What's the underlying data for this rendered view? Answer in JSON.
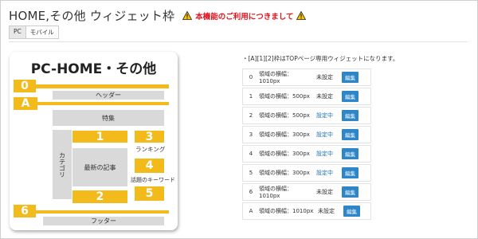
{
  "header": {
    "title": "HOME,その他 ウィジェット枠",
    "notice": "本機能のご利用につきまして"
  },
  "tabs": [
    {
      "label": "PC",
      "active": true
    },
    {
      "label": "モバイル",
      "active": false
    }
  ],
  "diagram": {
    "title": "PC-HOME・その他",
    "tags": [
      "0",
      "A",
      "6"
    ],
    "header_label": "ヘッダー",
    "special_label": "特集",
    "category_label": "カテゴリ",
    "latest_label": "最新の記事",
    "ranking_label": "ランキング",
    "keyword_label": "話題のキーワード",
    "footer_label": "フッター",
    "slots": [
      "1",
      "2",
      "3",
      "4",
      "5"
    ]
  },
  "widgets": {
    "note": "・[A][1][2]枠はTOPページ専用ウィジェットになります。",
    "edit_label": "編集",
    "rows": [
      {
        "id": "0",
        "desc": "領域の横幅：1010px",
        "status": "未設定",
        "set": false
      },
      {
        "id": "1",
        "desc": "領域の横幅：500px",
        "status": "未設定",
        "set": false
      },
      {
        "id": "2",
        "desc": "領域の横幅：500px",
        "status": "設定中",
        "set": true
      },
      {
        "id": "3",
        "desc": "領域の横幅：300px",
        "status": "設定中",
        "set": true
      },
      {
        "id": "4",
        "desc": "領域の横幅：300px",
        "status": "設定中",
        "set": true
      },
      {
        "id": "5",
        "desc": "領域の横幅：300px",
        "status": "設定中",
        "set": true
      },
      {
        "id": "6",
        "desc": "領域の横幅：1010px",
        "status": "未設定",
        "set": false
      },
      {
        "id": "A",
        "desc": "領域の横幅：1010px",
        "status": "未設定",
        "set": false
      }
    ]
  },
  "colors": {
    "accent": "#f3ba1b",
    "link": "#1d6fb8",
    "button": "#2e86c9",
    "warning": "#e0151f"
  }
}
